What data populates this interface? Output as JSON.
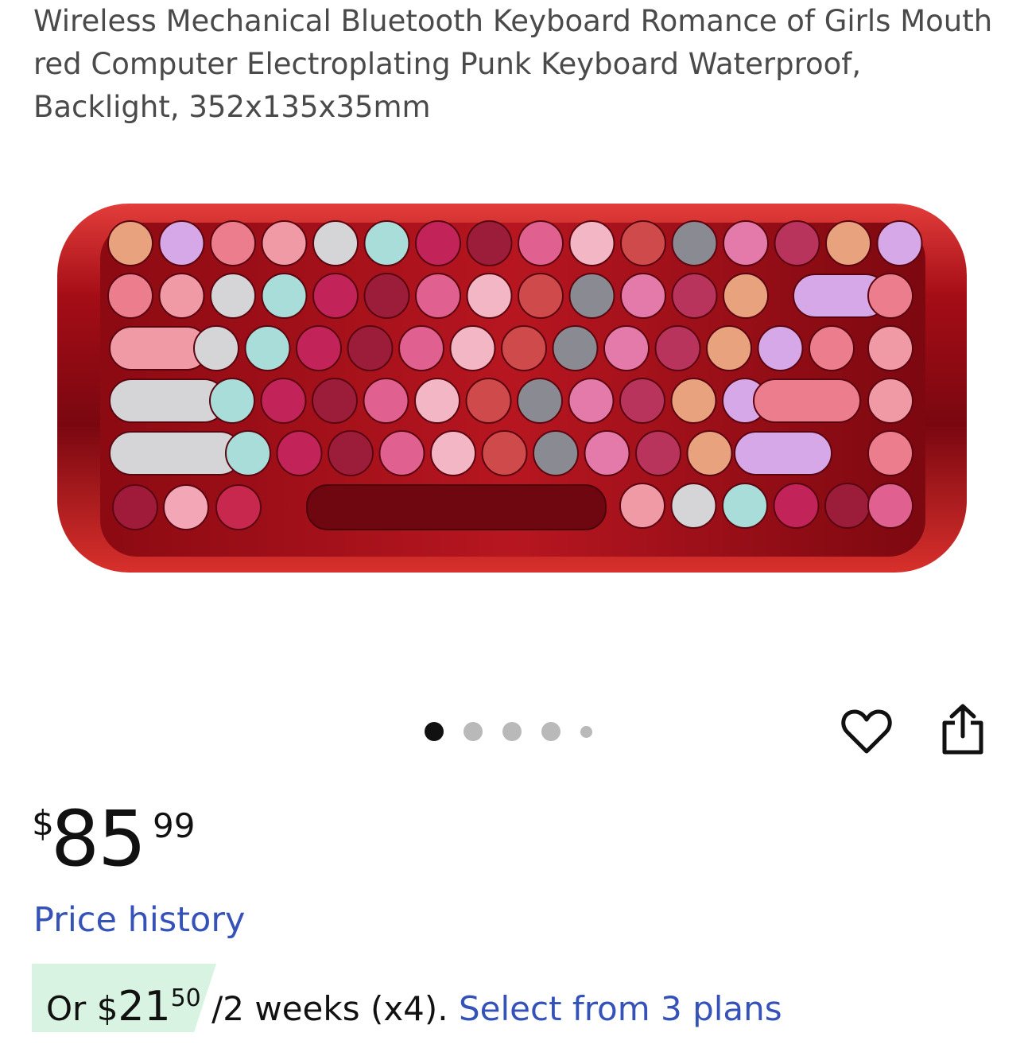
{
  "product": {
    "title": "Wireless Mechanical Bluetooth Keyboard Romance of Girls Mouth red Computer Electroplating Punk Keyboard Waterproof, Backlight, 352x135x35mm"
  },
  "carousel": {
    "count": 5,
    "active_index": 0
  },
  "actions": {
    "favorite_icon": "heart-icon",
    "share_icon": "share-icon"
  },
  "price": {
    "currency": "$",
    "whole": "85",
    "cents": "99"
  },
  "price_history_label": "Price history",
  "installment": {
    "prefix": "Or ",
    "currency": "$",
    "whole": "21",
    "cents": "50",
    "period": " /2 weeks (x4). ",
    "link": "Select from 3 plans"
  },
  "colors": {
    "link": "#3552b8",
    "badge_bg": "#d8f3e2",
    "keyboard_body": "#b0141c",
    "active_dot": "#111111",
    "inactive_dot": "#b9b9b9"
  }
}
